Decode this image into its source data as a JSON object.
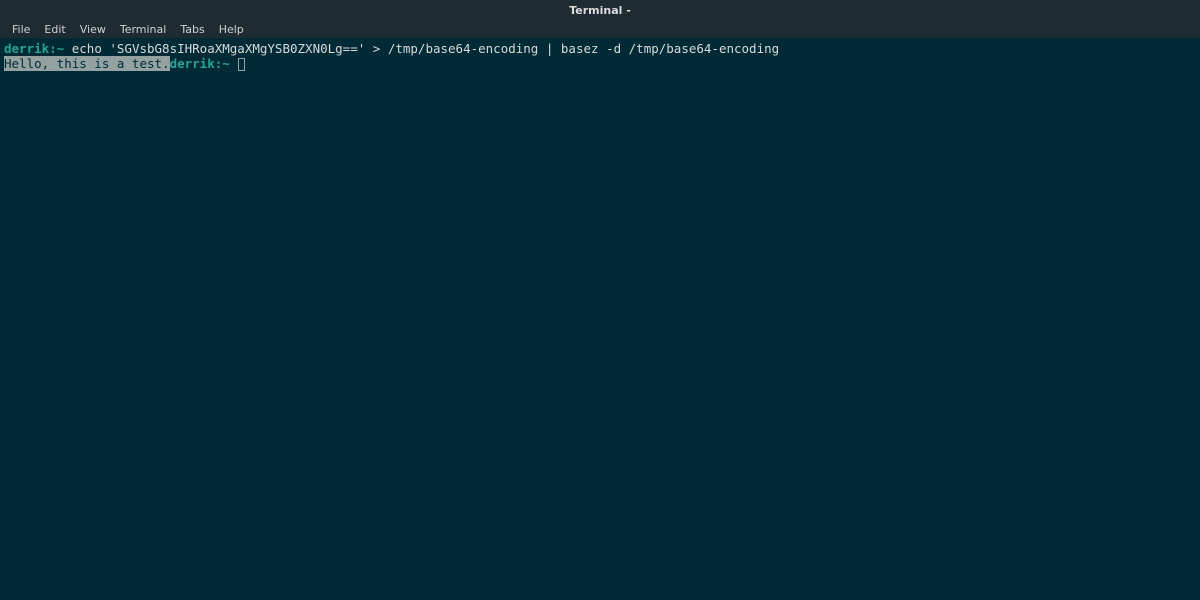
{
  "window": {
    "title": "Terminal -"
  },
  "menu": {
    "file": "File",
    "edit": "Edit",
    "view": "View",
    "terminal": "Terminal",
    "tabs": "Tabs",
    "help": "Help"
  },
  "terminal": {
    "line1": {
      "prompt": "derrik:~",
      "command": " echo 'SGVsbG8sIHRoaXMgaXMgYSB0ZXN0Lg==' > /tmp/base64-encoding | basez -d /tmp/base64-encoding"
    },
    "line2": {
      "output_highlighted": "Hello, this is a test.",
      "prompt": "derrik:~",
      "command": " "
    }
  }
}
